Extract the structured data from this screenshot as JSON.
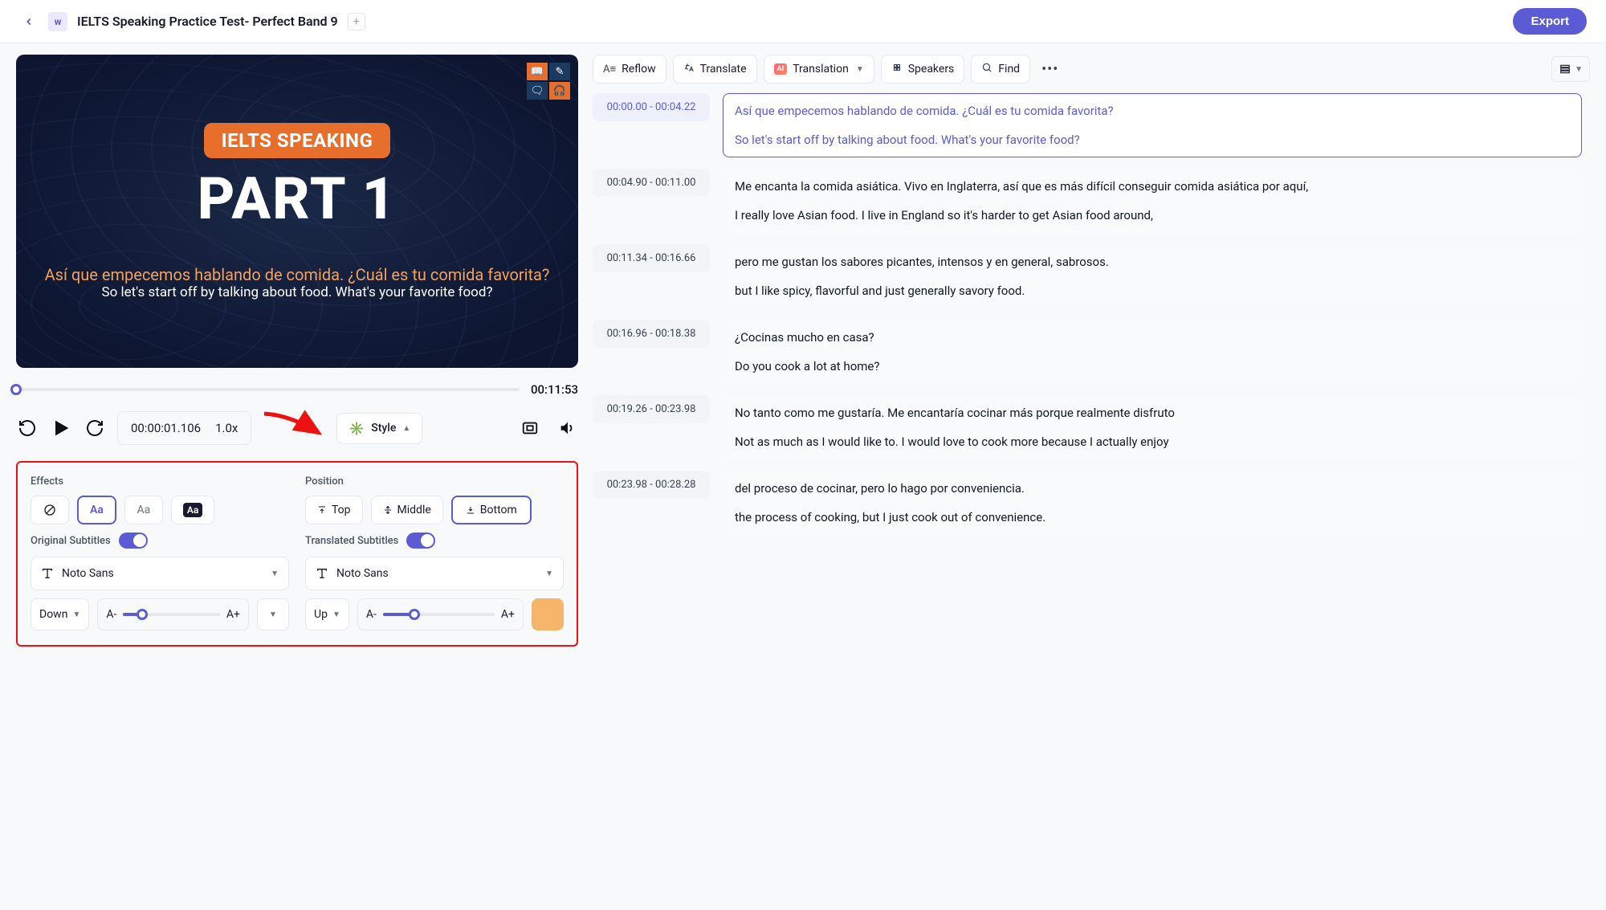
{
  "header": {
    "title": "IELTS Speaking Practice Test- Perfect Band 9",
    "export": "Export"
  },
  "video": {
    "pill": "IELTS SPEAKING",
    "big": "PART 1",
    "sub_es": "Así que empecemos hablando de comida. ¿Cuál es tu comida favorita?",
    "sub_en": "So let's start off by talking about food. What's your favorite food?",
    "duration": "00:11:53",
    "current_time": "00:00:01.106",
    "speed": "1.0x",
    "style_label": "Style"
  },
  "style_panel": {
    "effects_label": "Effects",
    "position_label": "Position",
    "positions": {
      "top": "Top",
      "middle": "Middle",
      "bottom": "Bottom"
    },
    "orig_label": "Original Subtitles",
    "trans_label": "Translated Subtitles",
    "font_orig": "Noto Sans",
    "font_trans": "Noto Sans",
    "dir_orig": "Down",
    "dir_trans": "Up",
    "a_minus": "A-",
    "a_plus": "A+",
    "color_trans": "#f5b56a"
  },
  "toolbar": {
    "reflow": "Reflow",
    "translate": "Translate",
    "translation": "Translation",
    "speakers": "Speakers",
    "find": "Find"
  },
  "segments": [
    {
      "start": "00:00.00",
      "end": "00:04.22",
      "trans": "Así que empecemos hablando de comida. ¿Cuál es tu comida favorita?",
      "orig": "So let's start off by talking about food. What's your favorite food?",
      "active": true
    },
    {
      "start": "00:04.90",
      "end": "00:11.00",
      "trans": "Me encanta la comida asiática. Vivo en Inglaterra, así que es más difícil conseguir comida asiática por aquí,",
      "orig": "I really love Asian food. I live in England so it's harder to get Asian food around,"
    },
    {
      "start": "00:11.34",
      "end": "00:16.66",
      "trans": "pero me gustan los sabores picantes, intensos y en general, sabrosos.",
      "orig": "but I like spicy, flavorful and just generally savory food."
    },
    {
      "start": "00:16.96",
      "end": "00:18.38",
      "trans": "¿Cocinas mucho en casa?",
      "orig": "Do you cook a lot at home?"
    },
    {
      "start": "00:19.26",
      "end": "00:23.98",
      "trans": "No tanto como me gustaría. Me encantaría cocinar más porque realmente disfruto",
      "orig": "Not as much as I would like to. I would love to cook more because I actually enjoy"
    },
    {
      "start": "00:23.98",
      "end": "00:28.28",
      "trans": "del proceso de cocinar, pero lo hago por conveniencia.",
      "orig": "the process of cooking, but I just cook out of convenience."
    }
  ]
}
